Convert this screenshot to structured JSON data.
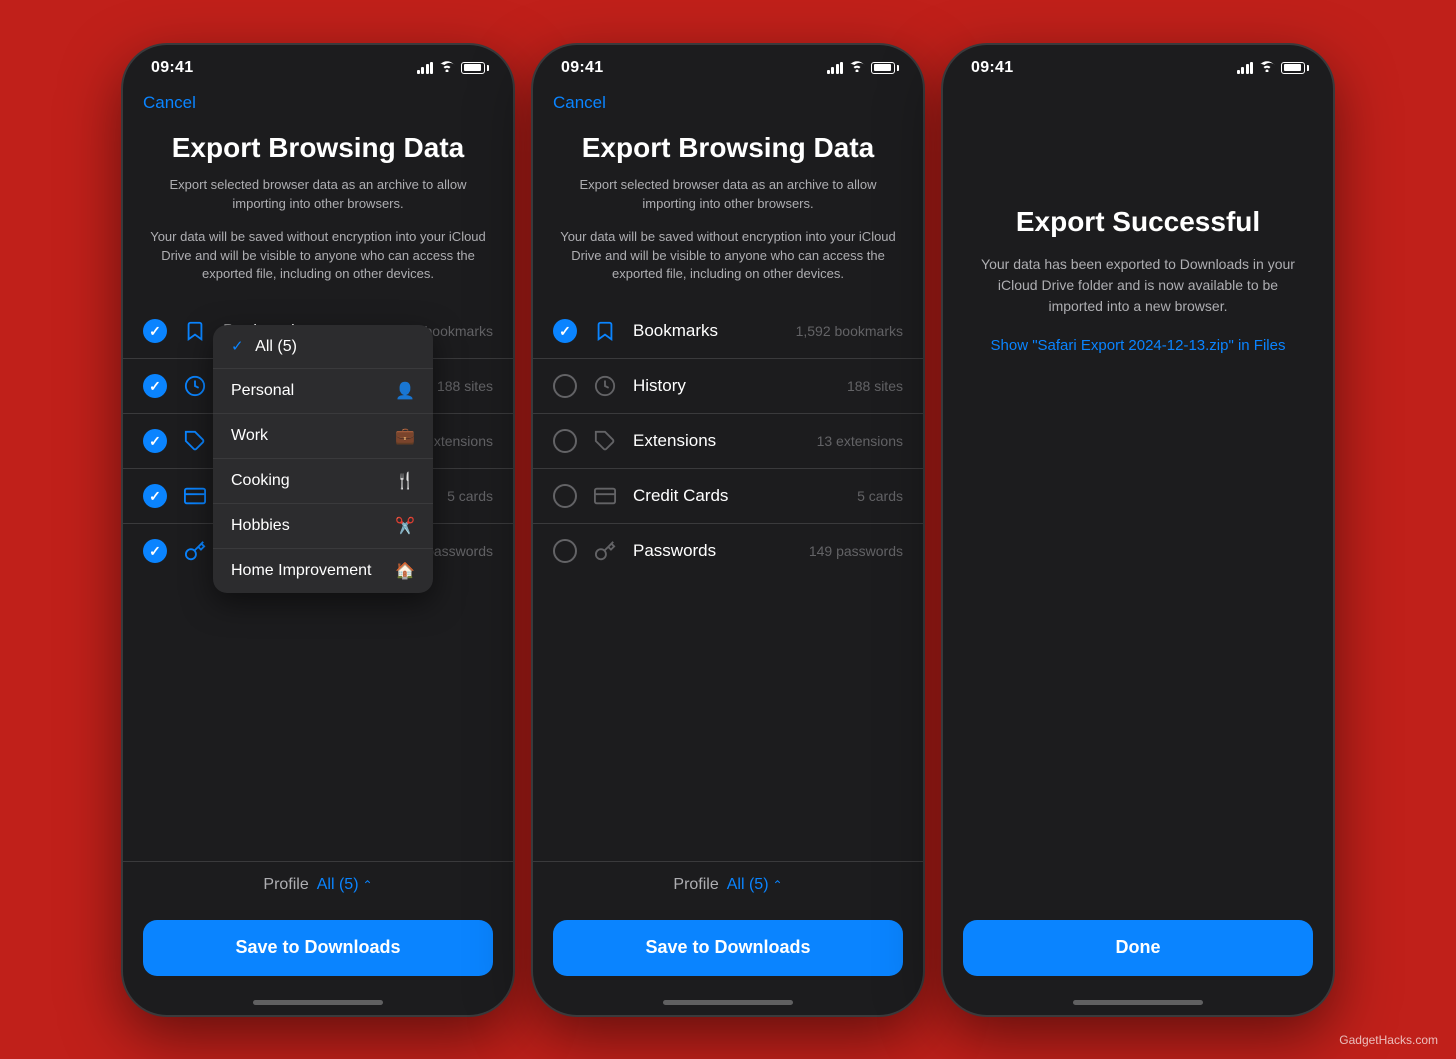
{
  "background_color": "#c01a1a",
  "watermark": "GadgetHacks.com",
  "phones": [
    {
      "id": "phone1",
      "time": "09:41",
      "cancel_label": "Cancel",
      "title": "Export Browsing Data",
      "subtitle1": "Export selected browser data as an archive to allow importing into other browsers.",
      "subtitle2": "Your data will be saved without encryption into your iCloud Drive and will be visible to anyone who can access the exported file, including on other devices.",
      "items": [
        {
          "id": "bookmarks",
          "label": "Bookmarks",
          "count": "1,592 bookmarks",
          "checked": true,
          "icon": "bookmark"
        },
        {
          "id": "history",
          "label": "History",
          "count": "188 sites",
          "checked": true,
          "icon": "clock"
        },
        {
          "id": "extensions",
          "label": "Extensions",
          "count": "13 extensions",
          "checked": true,
          "icon": "puzzle"
        },
        {
          "id": "credit-cards",
          "label": "Credit Cards",
          "count": "5 cards",
          "checked": true,
          "icon": "creditcard"
        },
        {
          "id": "passwords",
          "label": "Passwords",
          "count": "149 passwords",
          "checked": true,
          "icon": "key"
        }
      ],
      "profile_label": "Profile",
      "profile_value": "All (5)",
      "save_label": "Save to Downloads",
      "dropdown": {
        "items": [
          {
            "label": "All (5)",
            "selected": true,
            "icon": ""
          },
          {
            "label": "Personal",
            "selected": false,
            "icon": "person"
          },
          {
            "label": "Work",
            "selected": false,
            "icon": "briefcase"
          },
          {
            "label": "Cooking",
            "selected": false,
            "icon": "fork"
          },
          {
            "label": "Hobbies",
            "selected": false,
            "icon": "scissors"
          },
          {
            "label": "Home Improvement",
            "selected": false,
            "icon": "house"
          }
        ]
      }
    },
    {
      "id": "phone2",
      "time": "09:41",
      "cancel_label": "Cancel",
      "title": "Export Browsing Data",
      "subtitle1": "Export selected browser data as an archive to allow importing into other browsers.",
      "subtitle2": "Your data will be saved without encryption into your iCloud Drive and will be visible to anyone who can access the exported file, including on other devices.",
      "items": [
        {
          "id": "bookmarks",
          "label": "Bookmarks",
          "count": "1,592 bookmarks",
          "checked": true,
          "icon": "bookmark"
        },
        {
          "id": "history",
          "label": "History",
          "count": "188 sites",
          "checked": false,
          "icon": "clock"
        },
        {
          "id": "extensions",
          "label": "Extensions",
          "count": "13 extensions",
          "checked": false,
          "icon": "puzzle"
        },
        {
          "id": "credit-cards",
          "label": "Credit Cards",
          "count": "5 cards",
          "checked": false,
          "icon": "creditcard"
        },
        {
          "id": "passwords",
          "label": "Passwords",
          "count": "149 passwords",
          "checked": false,
          "icon": "key"
        }
      ],
      "profile_label": "Profile",
      "profile_value": "All (5)",
      "save_label": "Save to Downloads"
    },
    {
      "id": "phone3",
      "time": "09:41",
      "success_title": "Export Successful",
      "success_subtitle": "Your data has been exported to Downloads in your iCloud Drive folder and is now available to be imported into a new browser.",
      "success_link": "Show \"Safari Export 2024-12-13.zip\" in Files",
      "done_label": "Done"
    }
  ]
}
